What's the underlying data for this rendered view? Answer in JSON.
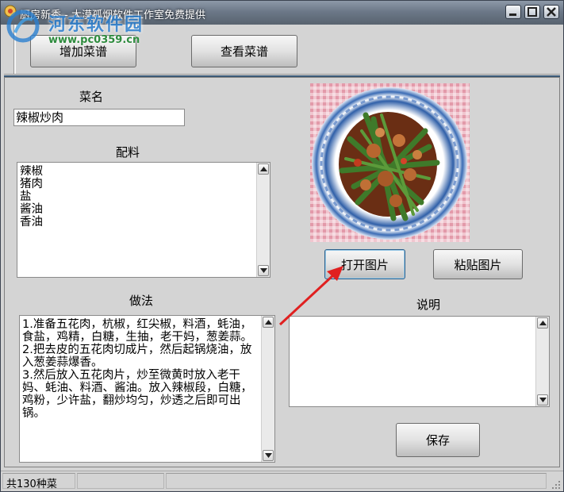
{
  "window": {
    "title": "厨房新秀 - 大漠孤烟软件工作室免费提供",
    "watermark": {
      "name": "河东软件园",
      "url": "www.pc0359.cn"
    }
  },
  "toolbar": {
    "add_recipe_label": "增加菜谱",
    "view_recipes_label": "查看菜谱"
  },
  "form": {
    "dish_name_label": "菜名",
    "dish_name_value": "辣椒炒肉",
    "ingredients_label": "配料",
    "ingredients_value": "辣椒\n猪肉\n盐\n酱油\n香油",
    "method_label": "做法",
    "method_value": "1.准备五花肉，杭椒，红尖椒，料酒，蚝油，食盐，鸡精，白糖，生抽，老干妈，葱姜蒜。\n2.把去皮的五花肉切成片，然后起锅烧油，放入葱姜蒜爆香。\n3.然后放入五花肉片，炒至微黄时放入老干妈、蚝油、料酒、酱油。放入辣椒段，白糖，鸡粉，少许盐，翻炒均匀，炒透之后即可出锅。",
    "notes_label": "说明",
    "notes_value": ""
  },
  "image_panel": {
    "open_image_label": "打开图片",
    "paste_image_label": "粘贴图片"
  },
  "actions": {
    "save_label": "保存"
  },
  "status": {
    "recipe_count_text": "共130种菜"
  },
  "colors": {
    "annotation_arrow": "#e02020",
    "titlebar": "#6c7888",
    "window_bg": "#d4d4d4"
  }
}
